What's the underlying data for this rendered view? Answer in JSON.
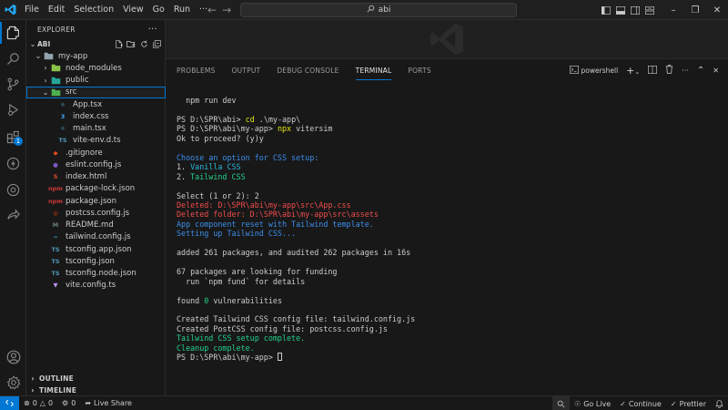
{
  "titlebar": {
    "menu": [
      "File",
      "Edit",
      "Selection",
      "View",
      "Go",
      "Run",
      "···"
    ],
    "search": "abi"
  },
  "activitybar": {
    "items": [
      "explorer-icon",
      "search-icon",
      "source-control-icon",
      "run-debug-icon",
      "extensions-icon",
      "thunder-client-icon",
      "copilot-icon",
      "live-share-icon"
    ],
    "extensions_badge": "1",
    "bottom": [
      "account-icon",
      "settings-gear-icon"
    ]
  },
  "sidebar": {
    "title": "EXPLORER",
    "more": "···",
    "workspace": "ABI",
    "tree": [
      {
        "label": "my-app",
        "depth": 1,
        "type": "folder-open"
      },
      {
        "label": "node_modules",
        "depth": 2,
        "type": "folder"
      },
      {
        "label": "public",
        "depth": 2,
        "type": "folder"
      },
      {
        "label": "src",
        "depth": 2,
        "type": "folder-open"
      },
      {
        "label": "App.tsx",
        "depth": 3,
        "type": "react"
      },
      {
        "label": "index.css",
        "depth": 3,
        "type": "css"
      },
      {
        "label": "main.tsx",
        "depth": 3,
        "type": "react"
      },
      {
        "label": "vite-env.d.ts",
        "depth": 3,
        "type": "ts"
      },
      {
        "label": ".gitignore",
        "depth": 2,
        "type": "git"
      },
      {
        "label": "eslint.config.js",
        "depth": 2,
        "type": "eslint"
      },
      {
        "label": "index.html",
        "depth": 2,
        "type": "html"
      },
      {
        "label": "package-lock.json",
        "depth": 2,
        "type": "npm"
      },
      {
        "label": "package.json",
        "depth": 2,
        "type": "npm"
      },
      {
        "label": "postcss.config.js",
        "depth": 2,
        "type": "postcss"
      },
      {
        "label": "README.md",
        "depth": 2,
        "type": "md"
      },
      {
        "label": "tailwind.config.js",
        "depth": 2,
        "type": "tailwind"
      },
      {
        "label": "tsconfig.app.json",
        "depth": 2,
        "type": "ts"
      },
      {
        "label": "tsconfig.json",
        "depth": 2,
        "type": "ts"
      },
      {
        "label": "tsconfig.node.json",
        "depth": 2,
        "type": "ts"
      },
      {
        "label": "vite.config.ts",
        "depth": 2,
        "type": "vite"
      }
    ],
    "sections": [
      "OUTLINE",
      "TIMELINE"
    ]
  },
  "panel": {
    "tabs": [
      "PROBLEMS",
      "OUTPUT",
      "DEBUG CONSOLE",
      "TERMINAL",
      "PORTS"
    ],
    "active_tab": "TERMINAL",
    "terminal_name": "powershell",
    "terminal_lines": [
      {
        "parts": [
          {
            "t": "  npm run dev",
            "c": ""
          }
        ]
      },
      {
        "parts": [
          {
            "t": "",
            "c": ""
          }
        ]
      },
      {
        "parts": [
          {
            "t": "PS D:\\SPR\\abi> ",
            "c": ""
          },
          {
            "t": "cd",
            "c": "t-cmd"
          },
          {
            "t": " .\\my-app\\",
            "c": ""
          }
        ]
      },
      {
        "parts": [
          {
            "t": "PS D:\\SPR\\abi\\my-app> ",
            "c": ""
          },
          {
            "t": "npx",
            "c": "t-cmd"
          },
          {
            "t": " vitersim",
            "c": ""
          }
        ]
      },
      {
        "parts": [
          {
            "t": "Ok to proceed? (y)y",
            "c": ""
          }
        ]
      },
      {
        "parts": [
          {
            "t": "",
            "c": ""
          }
        ]
      },
      {
        "parts": [
          {
            "t": "Choose an option for CSS setup:",
            "c": "t-blue"
          }
        ]
      },
      {
        "parts": [
          {
            "t": "1. ",
            "c": ""
          },
          {
            "t": "Vanilla CSS",
            "c": "t-cyan"
          }
        ]
      },
      {
        "parts": [
          {
            "t": "2. ",
            "c": ""
          },
          {
            "t": "Tailwind CSS",
            "c": "t-green"
          }
        ]
      },
      {
        "parts": [
          {
            "t": "",
            "c": ""
          }
        ]
      },
      {
        "parts": [
          {
            "t": "Select (1 or 2): 2",
            "c": ""
          }
        ]
      },
      {
        "parts": [
          {
            "t": "Deleted: D:\\SPR\\abi\\my-app\\src\\App.css",
            "c": "t-red"
          }
        ]
      },
      {
        "parts": [
          {
            "t": "Deleted folder: D:\\SPR\\abi\\my-app\\src\\assets",
            "c": "t-red"
          }
        ]
      },
      {
        "parts": [
          {
            "t": "App component reset with Tailwind template.",
            "c": "t-blue"
          }
        ]
      },
      {
        "parts": [
          {
            "t": "Setting up Tailwind CSS...",
            "c": "t-blue"
          }
        ]
      },
      {
        "parts": [
          {
            "t": "",
            "c": ""
          }
        ]
      },
      {
        "parts": [
          {
            "t": "added 261 packages, and audited 262 packages in 16s",
            "c": ""
          }
        ]
      },
      {
        "parts": [
          {
            "t": "",
            "c": ""
          }
        ]
      },
      {
        "parts": [
          {
            "t": "67 packages are looking for funding",
            "c": ""
          }
        ]
      },
      {
        "parts": [
          {
            "t": "  run `npm fund` for details",
            "c": ""
          }
        ]
      },
      {
        "parts": [
          {
            "t": "",
            "c": ""
          }
        ]
      },
      {
        "parts": [
          {
            "t": "found ",
            "c": ""
          },
          {
            "t": "0",
            "c": "t-num"
          },
          {
            "t": " vulnerabilities",
            "c": ""
          }
        ]
      },
      {
        "parts": [
          {
            "t": "",
            "c": ""
          }
        ]
      },
      {
        "parts": [
          {
            "t": "Created Tailwind CSS config file: tailwind.config.js",
            "c": ""
          }
        ]
      },
      {
        "parts": [
          {
            "t": "Created PostCSS config file: postcss.config.js",
            "c": ""
          }
        ]
      },
      {
        "parts": [
          {
            "t": "Tailwind CSS setup complete.",
            "c": "t-green"
          }
        ]
      },
      {
        "parts": [
          {
            "t": "Cleanup complete.",
            "c": "t-green"
          }
        ]
      },
      {
        "parts": [
          {
            "t": "PS D:\\SPR\\abi\\my-app> ",
            "c": ""
          }
        ],
        "cursor": true
      }
    ]
  },
  "statusbar": {
    "errors": "0",
    "warnings": "0",
    "ports": "0",
    "live_share": "Live Share",
    "go_live": "Go Live",
    "continue": "Continue",
    "prettier": "Prettier"
  },
  "colors": {
    "accent": "#0078d4",
    "background": "#1f1f1f",
    "sidebar": "#181818"
  }
}
